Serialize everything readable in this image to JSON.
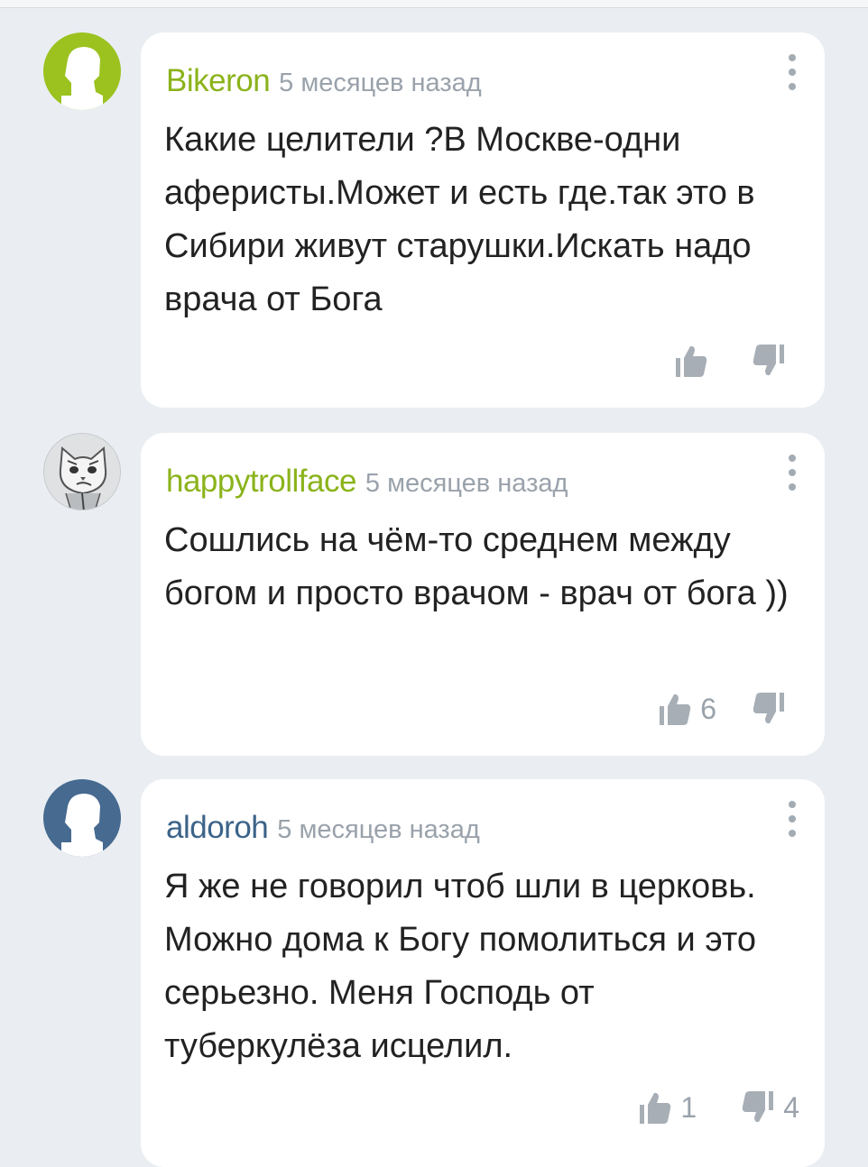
{
  "colors": {
    "author_green": "#8bb31b",
    "author_blue": "#3c6389",
    "icon_gray": "#a7aeb5"
  },
  "comments": [
    {
      "author": "Bikeron",
      "time": "5 месяцев назад",
      "text": "Какие целители ?В Москве-одни аферисты.Может и есть где.так это в Сибири живут старушки.Искать надо врача от Бога",
      "likes": "",
      "dislikes": "",
      "avatar": "silhouette-green"
    },
    {
      "author": "happytrollface",
      "time": "5 месяцев назад",
      "text": "Сошлись на чём-то среднем между богом и просто врачом - врач от бога ))",
      "likes": "6",
      "dislikes": "",
      "avatar": "cat-drawing"
    },
    {
      "author": "aldoroh",
      "time": "5 месяцев назад",
      "text": "Я же не говорил чтоб шли в церковь. Можно дома к Богу помолиться и это серьезно. Меня Господь от туберкулёза исцелил.",
      "likes": "1",
      "dislikes": "4",
      "avatar": "silhouette-blue"
    }
  ]
}
